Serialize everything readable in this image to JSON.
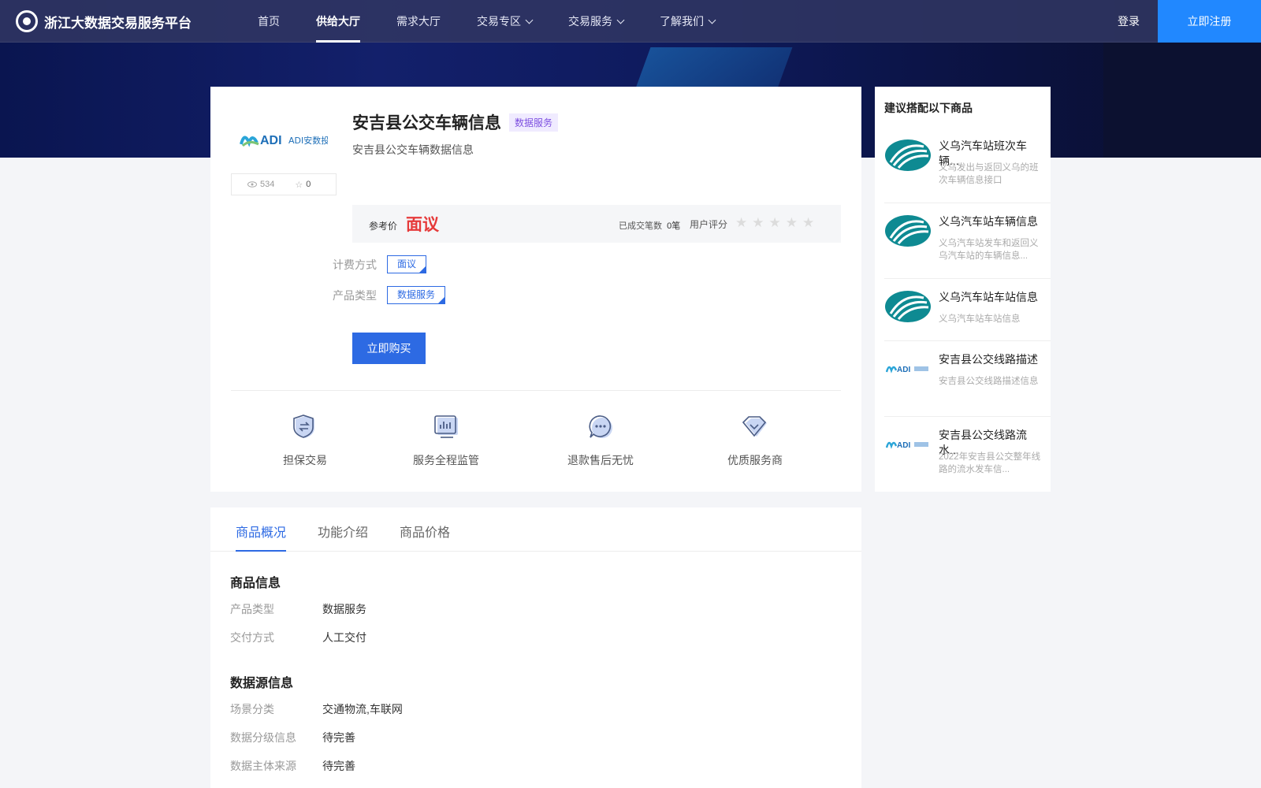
{
  "header": {
    "logo_text": "浙江大数据交易服务平台",
    "nav": [
      {
        "label": "首页"
      },
      {
        "label": "供给大厅",
        "active": true
      },
      {
        "label": "需求大厅"
      },
      {
        "label": "交易专区",
        "has_dropdown": true
      },
      {
        "label": "交易服务",
        "has_dropdown": true
      },
      {
        "label": "了解我们",
        "has_dropdown": true
      }
    ],
    "login_label": "登录",
    "register_label": "立即注册"
  },
  "product": {
    "name": "安吉县公交车辆信息",
    "tag": "数据服务",
    "description": "安吉县公交车辆数据信息",
    "views": "534",
    "favorites": "0",
    "price_label": "参考价",
    "price": "面议",
    "deals_text": "已成交笔数",
    "deals_count": "0笔",
    "rating_label": "用户评分",
    "rating_stars": "★★★★★",
    "rating_value": 0,
    "billing_label": "计费方式",
    "billing_value": "面议",
    "type_label": "产品类型",
    "type_value": "数据服务",
    "buy_label": "立即购买",
    "logo_text": "ADI安数投"
  },
  "features": [
    {
      "label": "担保交易",
      "icon": "shield-exchange-icon"
    },
    {
      "label": "服务全程监管",
      "icon": "monitor-chart-icon"
    },
    {
      "label": "退款售后无忧",
      "icon": "chat-bubble-icon"
    },
    {
      "label": "优质服务商",
      "icon": "diamond-icon"
    }
  ],
  "sidebar": {
    "title": "建议搭配以下商品",
    "items": [
      {
        "title": "义乌汽车站班次车辆...",
        "desc": "义乌发出与返回义乌的班次车辆信息接口",
        "logo": "yiwu-logo"
      },
      {
        "title": "义乌汽车站车辆信息",
        "desc": "义乌汽车站发车和返回义乌汽车站的车辆信息...",
        "logo": "yiwu-logo"
      },
      {
        "title": "义乌汽车站车站信息",
        "desc": "义乌汽车站车站信息",
        "logo": "yiwu-logo"
      },
      {
        "title": "安吉县公交线路描述",
        "desc": "安吉县公交线路描述信息",
        "logo": "adi-logo"
      },
      {
        "title": "安吉县公交线路流水...",
        "desc": "2022年安吉县公交整年线路的流水发车信...",
        "logo": "adi-logo"
      }
    ]
  },
  "tabs": [
    {
      "label": "商品概况",
      "active": true
    },
    {
      "label": "功能介绍"
    },
    {
      "label": "商品价格"
    }
  ],
  "product_info": {
    "title": "商品信息",
    "rows": [
      {
        "key": "产品类型",
        "value": "数据服务"
      },
      {
        "key": "交付方式",
        "value": "人工交付"
      }
    ]
  },
  "source_info": {
    "title": "数据源信息",
    "rows": [
      {
        "key": "场景分类",
        "value": "交通物流,车联网"
      },
      {
        "key": "数据分级信息",
        "value": "待完善"
      },
      {
        "key": "数据主体来源",
        "value": "待完善"
      }
    ]
  },
  "colors": {
    "primary": "#2d6ae3",
    "price_red": "#e63a3a",
    "register_blue": "#2188ff",
    "tag_purple": "#7d4fe0",
    "yiwu_teal": "#0e8a92"
  }
}
